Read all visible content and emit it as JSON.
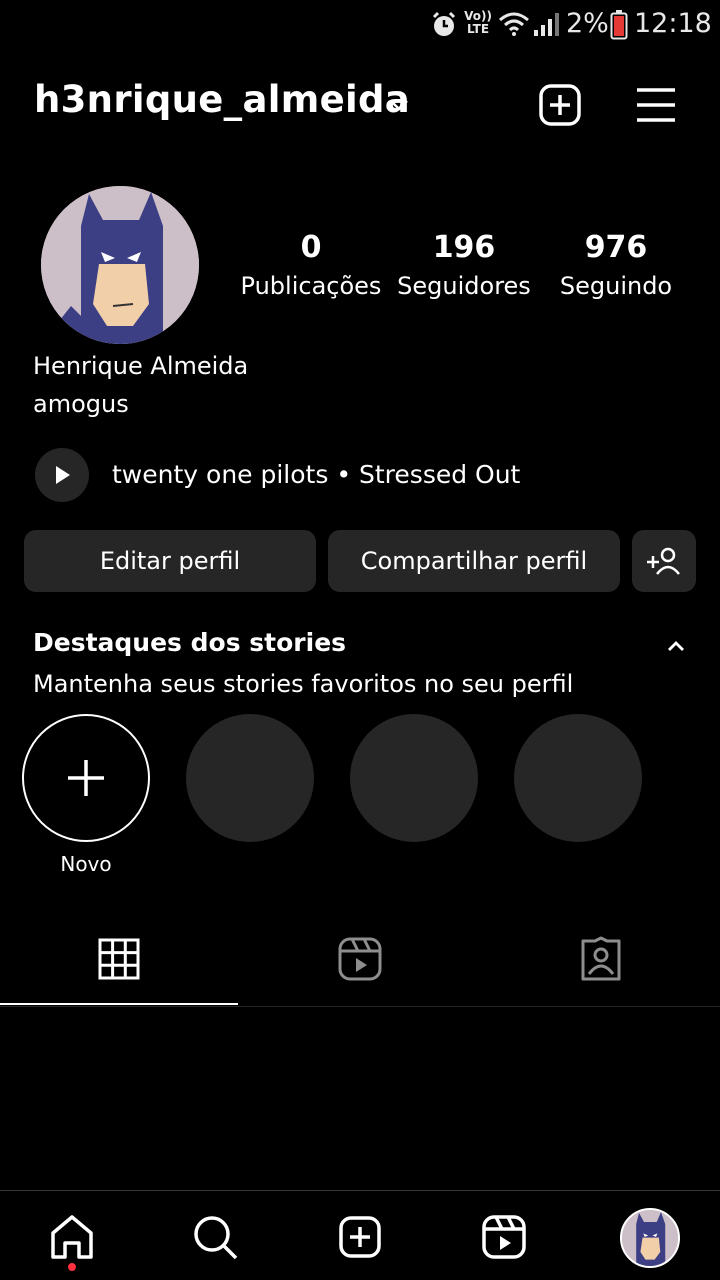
{
  "status_bar": {
    "network_label_top": "Vo))",
    "network_label_bottom": "LTE",
    "battery_percent": "2%",
    "time": "12:18",
    "icons": [
      "alarm-icon",
      "volte-icon",
      "wifi-icon",
      "signal-icon",
      "battery-icon"
    ]
  },
  "header": {
    "username": "h3nrique_almeida",
    "icons": [
      "chevron-down-icon",
      "add-post-icon",
      "menu-icon"
    ]
  },
  "profile": {
    "stats": [
      {
        "value": "0",
        "label": "Publicações"
      },
      {
        "value": "196",
        "label": "Seguidores"
      },
      {
        "value": "976",
        "label": "Seguindo"
      }
    ],
    "name": "Henrique Almeida",
    "bio": "amogus",
    "music": "twenty one pilots • Stressed Out"
  },
  "buttons": {
    "edit_profile": "Editar perfil",
    "share_profile": "Compartilhar perfil"
  },
  "highlights": {
    "title": "Destaques dos stories",
    "subtitle": "Mantenha seus stories favoritos no seu perfil",
    "new_label": "Novo"
  },
  "tabs": [
    "grid-icon",
    "reels-icon",
    "tagged-icon"
  ],
  "bottom_nav": [
    "home-icon",
    "search-icon",
    "create-icon",
    "reels-icon",
    "profile-avatar"
  ],
  "colors": {
    "background": "#000000",
    "surface": "#262626",
    "text": "#ffffff",
    "notification_dot": "#ff3040",
    "battery_low": "#e53935"
  }
}
